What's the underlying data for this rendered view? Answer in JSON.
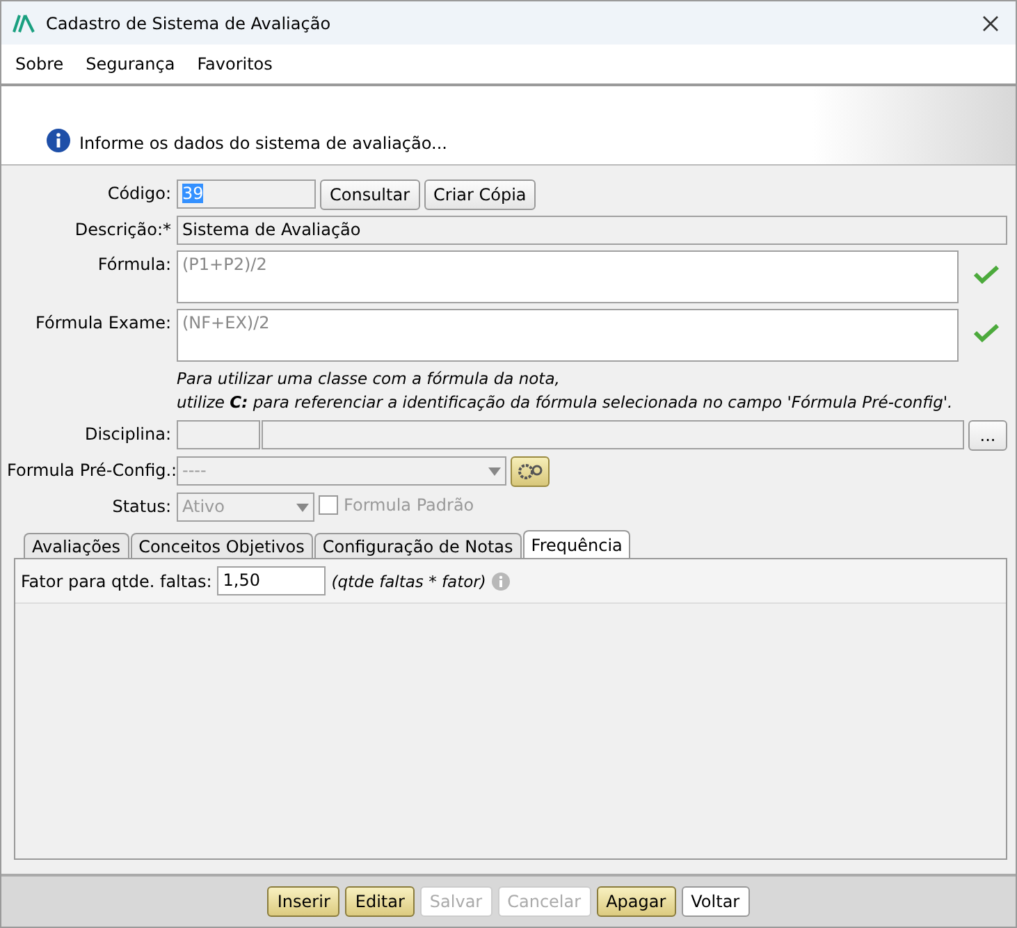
{
  "window": {
    "title": "Cadastro de Sistema de Avaliação"
  },
  "menu": [
    "Sobre",
    "Segurança",
    "Favoritos"
  ],
  "banner": {
    "message": "Informe os dados do sistema de avaliação..."
  },
  "form": {
    "codigo": {
      "label": "Código:",
      "value": "39",
      "selected": true
    },
    "codigo_buttons": [
      "Consultar",
      "Criar Cópia"
    ],
    "descricao": {
      "label": "Descrição:*",
      "value": "Sistema de Avaliação"
    },
    "formulas": [
      {
        "label": "Fórmula:",
        "value": "(P1+P2)/2",
        "valid": true
      },
      {
        "label": "Fórmula Exame:",
        "value": "(NF+EX)/2",
        "valid": true
      }
    ],
    "hint": [
      "Para utilizar uma classe com a fórmula da nota,",
      "utilize **C:** *para referenciar a identificação da fórmula selecionada no campo 'Fórmula Pré-config'.*"
    ],
    "disciplina": {
      "label": "Disciplina:",
      "browse": "..."
    },
    "pre_config": {
      "label": "Formula Pré-Config.:",
      "value": "----"
    },
    "status": {
      "label": "Status:",
      "value": "Ativo",
      "disabled": true
    },
    "formula_padrao": {
      "label": "Formula Padrão",
      "checked": false,
      "disabled": true
    }
  },
  "tabs": [
    {
      "label": "Avaliações",
      "selected": false
    },
    {
      "label": "Conceitos Objetivos",
      "selected": false
    },
    {
      "label": "Configuração de Notas",
      "selected": false
    },
    {
      "label": "Frequência",
      "selected": true
    }
  ],
  "tab_panel": {
    "label": "Fator para qtde. faltas:",
    "value": "1,50",
    "note": "(qtde faltas * fator)"
  },
  "buttons": [
    {
      "label": "Inserir",
      "kind": "accent",
      "disabled": false
    },
    {
      "label": "Editar",
      "kind": "accent",
      "disabled": false
    },
    {
      "label": "Salvar",
      "kind": "plain",
      "disabled": true
    },
    {
      "label": "Cancelar",
      "kind": "plain",
      "disabled": true
    },
    {
      "label": "Apagar",
      "kind": "accent",
      "disabled": false
    },
    {
      "label": "Voltar",
      "kind": "plain",
      "disabled": false
    }
  ]
}
